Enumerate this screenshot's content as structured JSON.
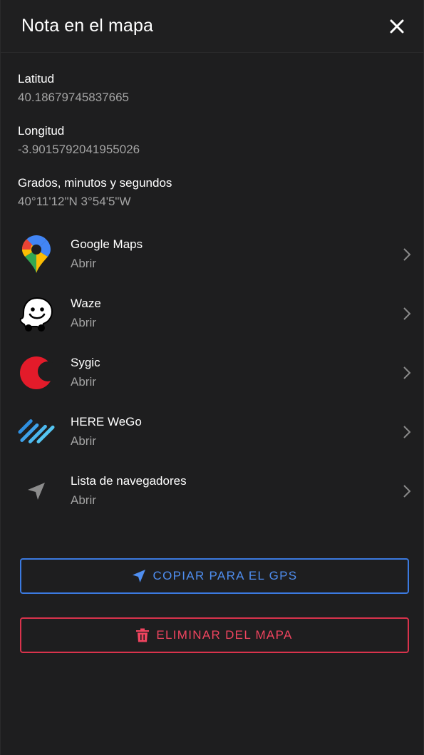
{
  "header": {
    "title": "Nota en el mapa",
    "close_icon": "close-icon"
  },
  "info": [
    {
      "label": "Latitud",
      "value": "40.18679745837665"
    },
    {
      "label": "Longitud",
      "value": "-3.9015792041955026"
    },
    {
      "label": "Grados, minutos y segundos",
      "value": "40°11'12\"N 3°54'5\"W"
    }
  ],
  "apps": [
    {
      "name": "Google Maps",
      "action": "Abrir",
      "icon": "google-maps-icon"
    },
    {
      "name": "Waze",
      "action": "Abrir",
      "icon": "waze-icon"
    },
    {
      "name": "Sygic",
      "action": "Abrir",
      "icon": "sygic-icon"
    },
    {
      "name": "HERE WeGo",
      "action": "Abrir",
      "icon": "here-wego-icon"
    },
    {
      "name": "Lista de navegadores",
      "action": "Abrir",
      "icon": "navigation-arrow-icon"
    }
  ],
  "buttons": {
    "copy_gps": {
      "label": "COPIAR PARA EL GPS",
      "icon": "navigation-arrow-icon",
      "color": "#3b7ae0"
    },
    "delete": {
      "label": "ELIMINAR DEL MAPA",
      "icon": "trash-icon",
      "color": "#d9334c"
    }
  },
  "colors": {
    "background": "#1e1e1f",
    "muted_text": "#a3a3a3"
  }
}
